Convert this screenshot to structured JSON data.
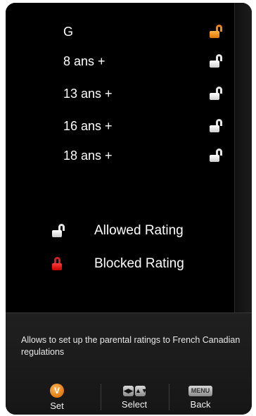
{
  "ratings": [
    {
      "label": "G",
      "lock_state": "unlocked",
      "highlighted": true
    },
    {
      "label": "8 ans +",
      "lock_state": "unlocked",
      "highlighted": false
    },
    {
      "label": "13 ans +",
      "lock_state": "unlocked",
      "highlighted": false
    },
    {
      "label": "16 ans +",
      "lock_state": "unlocked",
      "highlighted": false
    },
    {
      "label": "18 ans +",
      "lock_state": "unlocked",
      "highlighted": false
    }
  ],
  "legend": {
    "allowed": {
      "label": "Allowed Rating",
      "icon": "unlocked-lock-icon"
    },
    "blocked": {
      "label": "Blocked Rating",
      "icon": "locked-lock-icon"
    }
  },
  "help": {
    "text": "Allows to set up the parental ratings to French Canadian regulations"
  },
  "buttons": {
    "set": {
      "label": "Set",
      "icon_text": "V"
    },
    "select": {
      "label": "Select",
      "left_icon": "◀▶",
      "right_icon": "▲▼"
    },
    "back": {
      "label": "Back",
      "icon_text": "MENU"
    }
  },
  "colors": {
    "highlight_lock": "#f08a12",
    "blocked_lock": "#d42020",
    "allowed_lock": "#ffffff"
  }
}
